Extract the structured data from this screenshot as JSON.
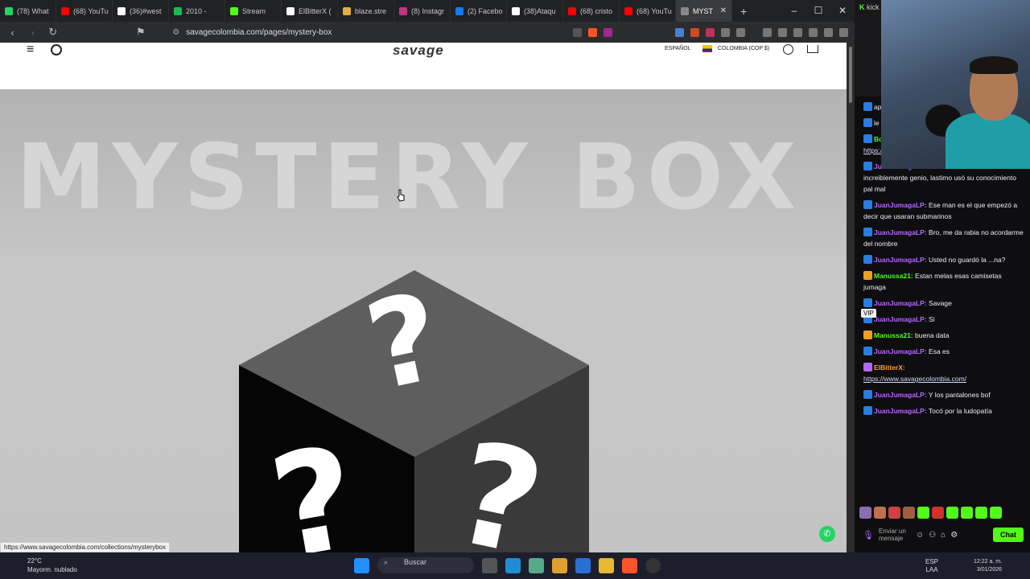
{
  "browser": {
    "tabs": [
      {
        "label": "(78) What",
        "color": "#25d366"
      },
      {
        "label": "(68) YouTu",
        "color": "#ff0000"
      },
      {
        "label": "(36)#west",
        "color": "#ffffff"
      },
      {
        "label": "2010 -",
        "color": "#1db954"
      },
      {
        "label": "Stream",
        "color": "#53fc18"
      },
      {
        "label": "ElBitterX (",
        "color": "#ffffff"
      },
      {
        "label": "blaze.stre",
        "color": "#e0b040"
      },
      {
        "label": "(8) Instagr",
        "color": "#c13584"
      },
      {
        "label": "(2) Facebo",
        "color": "#1877f2"
      },
      {
        "label": "(38)Ataqu",
        "color": "#ffffff"
      },
      {
        "label": "(68) cristo",
        "color": "#ff0000"
      },
      {
        "label": "(68) YouTu",
        "color": "#ff0000"
      },
      {
        "label": "MYST",
        "color": "#888888",
        "active": true
      }
    ],
    "url": "savagecolombia.com/pages/mystery-box",
    "status_url": "https://www.savagecolombia.com/collections/mysterybox"
  },
  "site": {
    "logo": "savage",
    "language": "ESPAÑOL",
    "currency": "COLOMBIA (COP $)",
    "hero_title": "MYSTERY BOX"
  },
  "side": {
    "kick_tab": "kick"
  },
  "chat": {
    "messages": [
      {
        "user": "",
        "text": "aprox",
        "user_color": "#ffffff",
        "badge": "#2a7de1"
      },
      {
        "user": "",
        "text": "le ma... hace... que era",
        "user_color": "#ffffff",
        "badge": "#2a7de1"
      },
      {
        "user": "BotRix:",
        "text": "",
        "link": "https://t.me/+dA47rzGKuBg1Mzkx",
        "user_color": "#53fc18",
        "badge": "#2a7de1"
      },
      {
        "user": "JuanJumagaLP:",
        "text": "Carlos Lehder es increiblemente genio, lastimo usó su conocimiento pal mal",
        "user_color": "#b468ff",
        "badge": "#2a7de1"
      },
      {
        "user": "JuanJumagaLP:",
        "text": "Ese man es el que empezó a decir que usaran submarinos",
        "user_color": "#b468ff",
        "badge": "#2a7de1"
      },
      {
        "user": "JuanJumagaLP:",
        "text": "Bro, me da rabia no acordarme del nombre",
        "user_color": "#b468ff",
        "badge": "#2a7de1"
      },
      {
        "user": "JuanJumagaLP:",
        "text": "Usted no guardó la ...na?",
        "user_color": "#b468ff",
        "badge": "#2a7de1"
      },
      {
        "user": "Manussa21:",
        "text": "Estan melas esas camisetas jumaga",
        "user_color": "#53fc18",
        "badge": "#f0a020"
      },
      {
        "user": "JuanJumagaLP:",
        "text": "Savage",
        "user_color": "#b468ff",
        "badge": "#2a7de1"
      },
      {
        "user": "JuanJumagaLP:",
        "text": "Si",
        "user_color": "#b468ff",
        "badge": "#2a7de1"
      },
      {
        "user": "Manussa21:",
        "text": "buena data",
        "user_color": "#53fc18",
        "badge": "#f0a020"
      },
      {
        "user": "JuanJumagaLP:",
        "text": "Esa es",
        "user_color": "#b468ff",
        "badge": "#2a7de1"
      },
      {
        "user": "ElBitterX:",
        "text": "",
        "link": "https://www.savagecolombia.com/",
        "user_color": "#ff9a3c",
        "badge": "#b468ff"
      },
      {
        "user": "JuanJumagaLP:",
        "text": "Y los pantalones bof",
        "user_color": "#b468ff",
        "badge": "#2a7de1"
      },
      {
        "user": "JuanJumagaLP:",
        "text": "Tocó por la ludopatía",
        "user_color": "#b468ff",
        "badge": "#2a7de1"
      }
    ],
    "vip_label": "VIP",
    "send_placeholder": "Enviar un mensaje",
    "chat_button": "Chat"
  },
  "taskbar": {
    "temp": "22°C",
    "weather": "Mayorm. nublado",
    "search": "Buscar",
    "lang_top": "ESP",
    "lang_bottom": "LAA",
    "time": "12:22 a. m.",
    "date": "3/01/2026"
  }
}
